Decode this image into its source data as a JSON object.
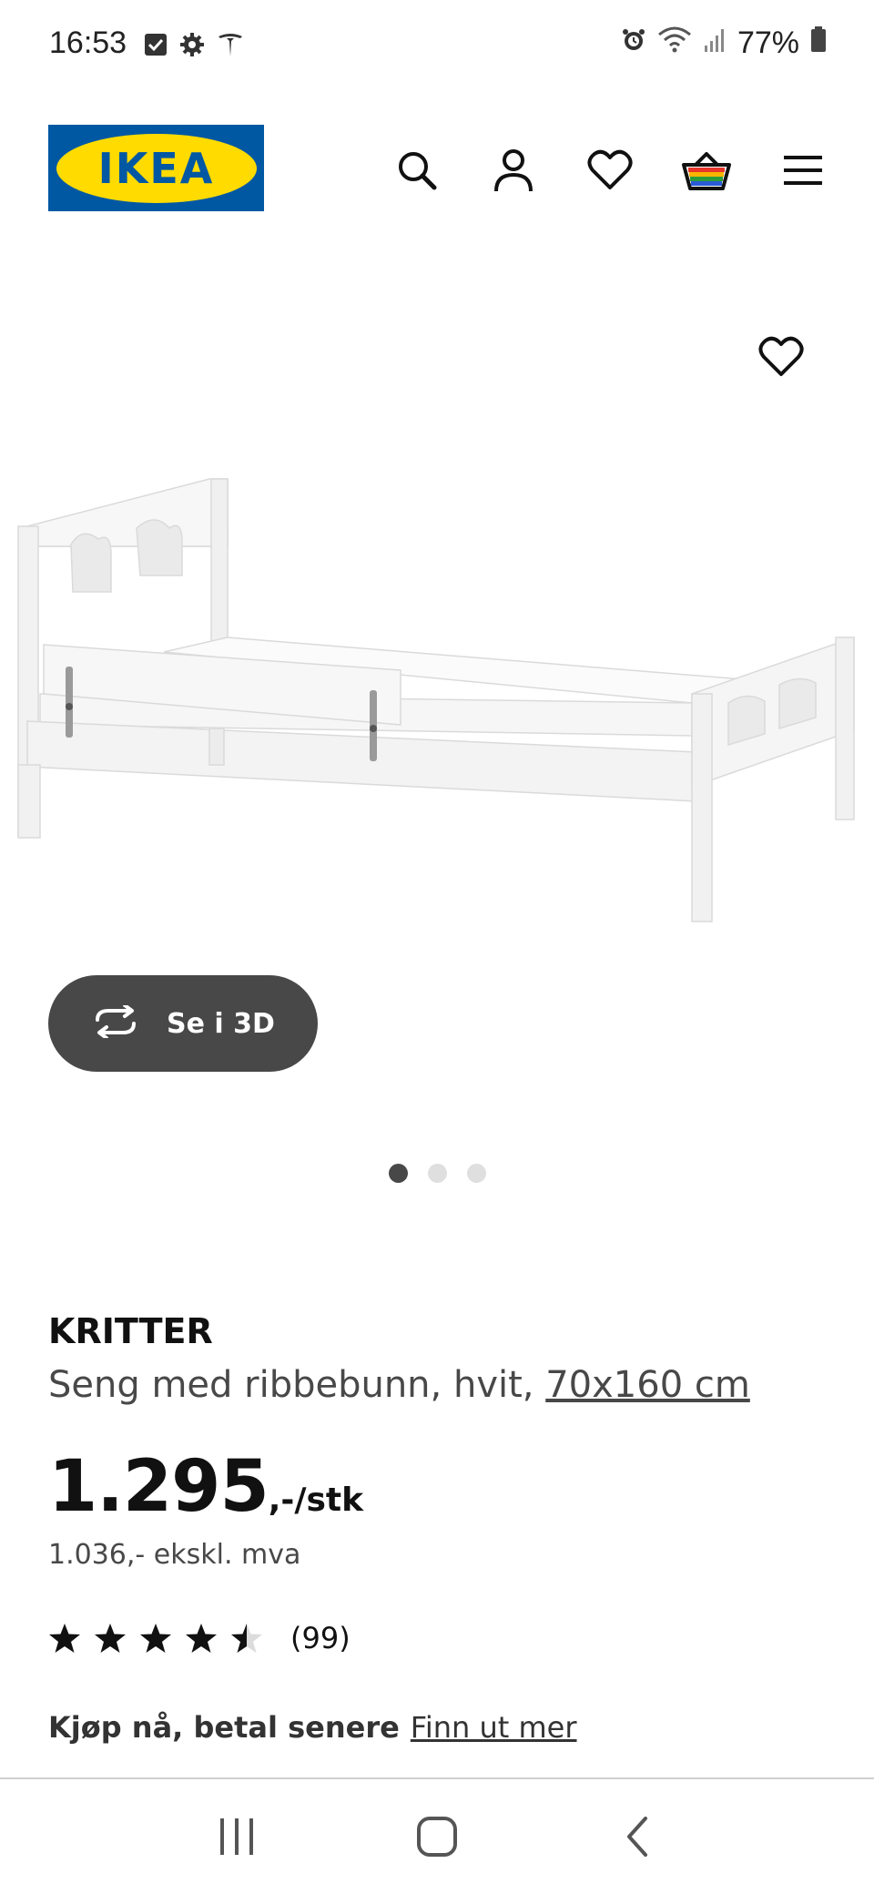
{
  "status_bar": {
    "time": "16:53",
    "battery": "77%"
  },
  "header": {
    "logo_text": "IKEA",
    "brand_colors": {
      "blue": "#0058a3",
      "yellow": "#ffdb00"
    },
    "icons": [
      "search-icon",
      "user-icon",
      "heart-icon",
      "basket-icon",
      "menu-icon"
    ]
  },
  "gallery": {
    "button_3d_label": "Se i 3D",
    "dot_count": 3,
    "active_dot": 1
  },
  "product": {
    "name": "KRITTER",
    "description": "Seng med ribbebunn, hvit,",
    "size_link": "70x160 cm",
    "price": "1.295",
    "price_suffix": ",-/stk",
    "price_ex_vat": "1.036,- ekskl. mva",
    "rating_value": 4.5,
    "rating_max": 5,
    "rating_count": "(99)"
  },
  "pay_later": {
    "label": "Kjøp nå, betal senere",
    "link": "Finn ut mer"
  }
}
